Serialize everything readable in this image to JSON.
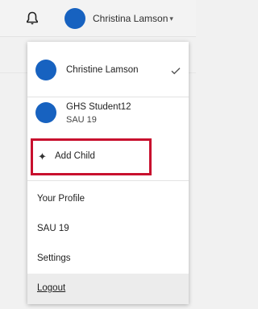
{
  "header": {
    "user_name": "Christina Lamson",
    "caret": "▾",
    "avatar_color": "#1762c0"
  },
  "menu": {
    "accounts": [
      {
        "name": "Christine Lamson",
        "selected": true
      },
      {
        "name": "GHS Student12",
        "subtitle": "SAU 19",
        "selected": false
      }
    ],
    "add_child_label": "Add Child",
    "add_child_icon": "plus-icon",
    "links": [
      "Your Profile",
      "SAU 19",
      "Settings"
    ],
    "logout_label": "Logout",
    "highlight_color": "#c8102e"
  }
}
